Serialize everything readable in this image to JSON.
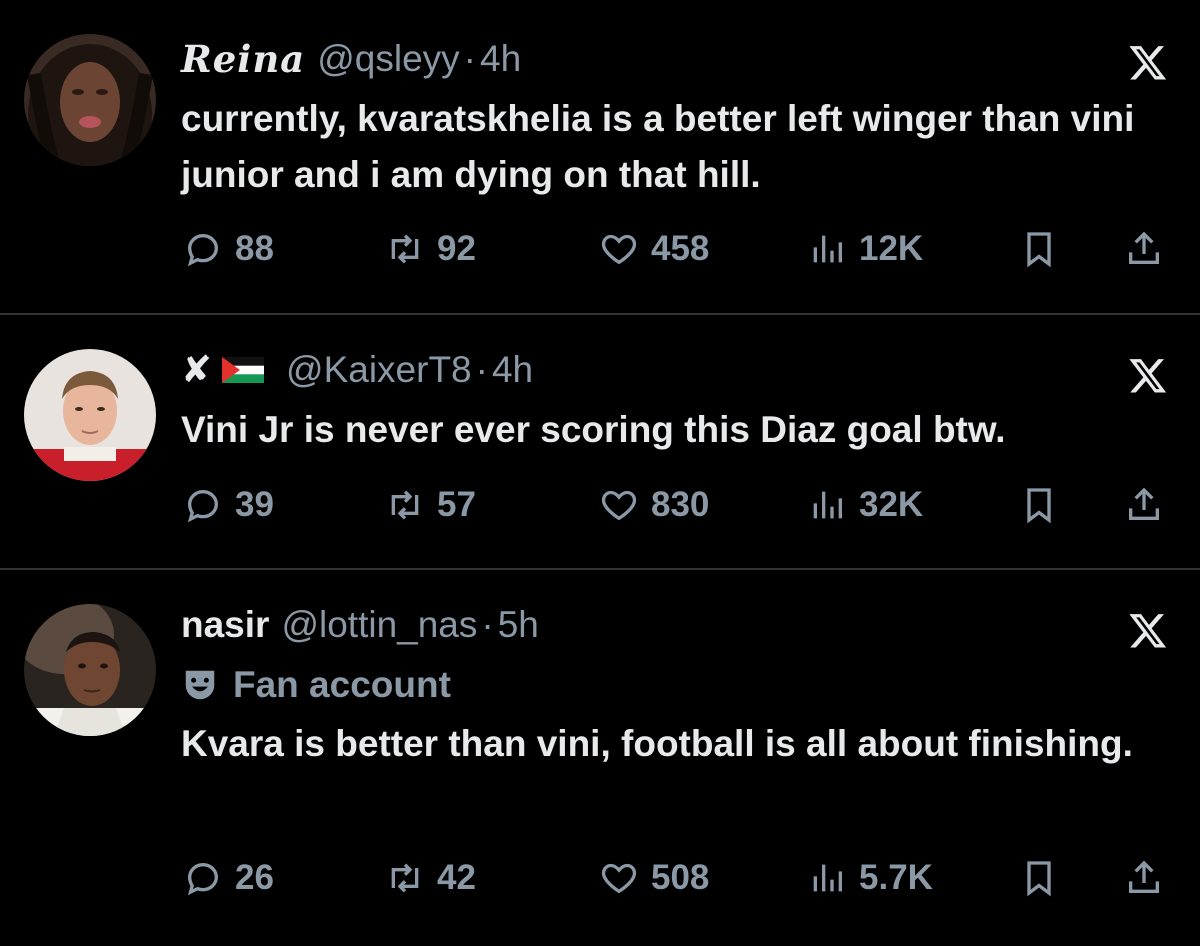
{
  "tweets": [
    {
      "name": "Reina",
      "handle": "@qsleyy",
      "separator": "·",
      "time": "4h",
      "label": "",
      "text": "currently, kvaratskhelia is a better left winger than vini junior and i am dying on that hill.",
      "stats": {
        "replies": "88",
        "retweets": "92",
        "likes": "458",
        "views": "12K"
      }
    },
    {
      "name": "✘",
      "handle": "@KaixerT8",
      "separator": "·",
      "time": "4h",
      "label": "",
      "text": "Vini Jr is never ever scoring this Diaz goal btw.",
      "stats": {
        "replies": "39",
        "retweets": "57",
        "likes": "830",
        "views": "32K"
      }
    },
    {
      "name": "nasir",
      "handle": "@lottin_nas",
      "separator": "·",
      "time": "5h",
      "label": "Fan account",
      "text": "Kvara is better than vini, football is all about finishing.",
      "stats": {
        "replies": "26",
        "retweets": "42",
        "likes": "508",
        "views": "5.7K"
      }
    }
  ],
  "icons": {
    "reply": "reply-icon",
    "retweet": "retweet-icon",
    "like": "heart-icon",
    "views": "views-icon",
    "bookmark": "bookmark-icon",
    "share": "share-icon",
    "platform": "x-logo-icon",
    "fan": "theater-masks-icon"
  },
  "colors": {
    "background": "#000000",
    "text": "#e7e9ea",
    "muted": "#8b98a5",
    "divider": "#2f3336"
  }
}
